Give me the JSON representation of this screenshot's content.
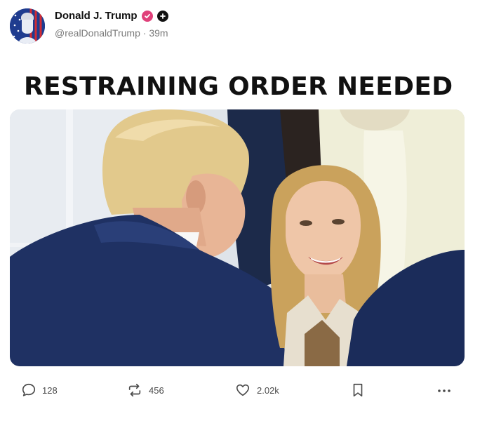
{
  "post": {
    "author": {
      "display_name": "Donald J. Trump",
      "handle": "@realDonaldTrump",
      "separator": "·",
      "time_ago": "39m"
    },
    "headline": "RESTRAINING ORDER NEEDED",
    "stats": {
      "replies": "128",
      "reposts": "456",
      "likes": "2.02k"
    }
  },
  "colors": {
    "verified_badge": "#e0407a",
    "text_primary": "#111111",
    "text_secondary": "#7a7a7a",
    "icon": "#4a4a4a"
  },
  "icons": {
    "verified": "verified-check-icon",
    "plus": "plus-icon",
    "reply": "speech-bubble-icon",
    "repost": "repost-arrows-icon",
    "like": "heart-icon",
    "bookmark": "bookmark-icon",
    "more": "more-dots-icon"
  }
}
